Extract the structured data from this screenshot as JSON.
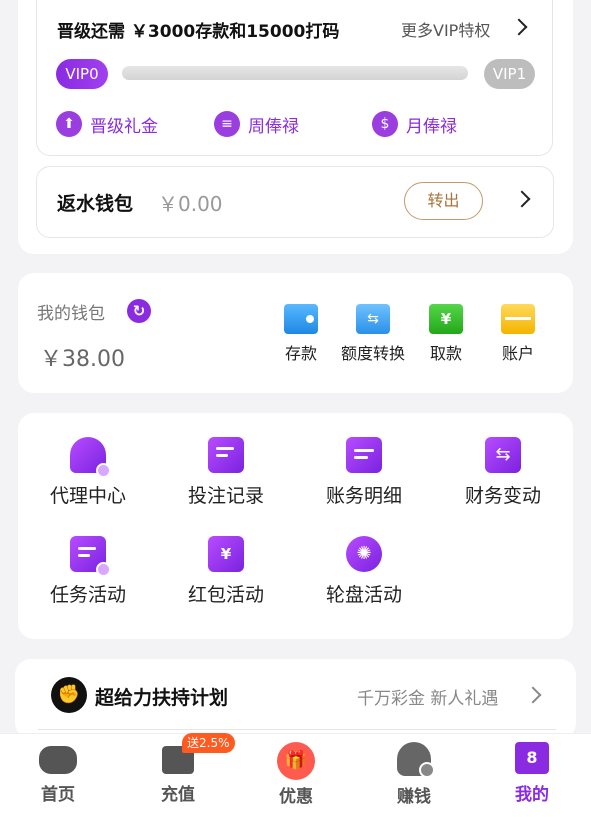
{
  "vip": {
    "upgrade_text": "晋级还需 ￥3000存款和15000打码",
    "more_label": "更多VIP特权",
    "current_level": "VIP0",
    "next_level": "VIP1",
    "progress": 0,
    "perks": [
      {
        "label": "晋级礼金",
        "icon": "upgrade-arrow-icon"
      },
      {
        "label": "周俸禄",
        "icon": "clipboard-icon"
      },
      {
        "label": "月俸禄",
        "icon": "money-bag-icon"
      }
    ]
  },
  "rebate": {
    "label": "返水钱包",
    "amount": "￥0.00",
    "transfer_label": "转出"
  },
  "wallet": {
    "label": "我的钱包",
    "amount": "￥38.00",
    "actions": [
      {
        "label": "存款",
        "icon": "wallet-icon"
      },
      {
        "label": "额度转换",
        "icon": "transfer-card-icon"
      },
      {
        "label": "取款",
        "icon": "atm-yuan-icon"
      },
      {
        "label": "账户",
        "icon": "card-icon"
      }
    ]
  },
  "menu": {
    "items": [
      {
        "label": "代理中心",
        "icon": "agent-user-icon"
      },
      {
        "label": "投注记录",
        "icon": "bet-record-icon"
      },
      {
        "label": "账务明细",
        "icon": "ledger-calendar-icon"
      },
      {
        "label": "财务变动",
        "icon": "finance-change-icon"
      },
      {
        "label": "任务活动",
        "icon": "task-icon"
      },
      {
        "label": "红包活动",
        "icon": "red-envelope-icon"
      },
      {
        "label": "轮盘活动",
        "icon": "roulette-icon"
      }
    ]
  },
  "support": {
    "title": "超给力扶持计划",
    "subtitle": "千万彩金 新人礼遇"
  },
  "tabbar": {
    "promo_badge": "送2.5%",
    "tabs": [
      {
        "label": "首页",
        "icon": "gamepad-icon"
      },
      {
        "label": "充值",
        "icon": "recharge-wallet-icon"
      },
      {
        "label": "优惠",
        "icon": "gift-icon"
      },
      {
        "label": "赚钱",
        "icon": "earn-user-icon"
      },
      {
        "label": "我的",
        "icon": "my-shirt-icon"
      }
    ]
  },
  "colors": {
    "accent": "#8a2be2",
    "brand_gold": "#a8743c",
    "promo": "#ff5a1f"
  }
}
